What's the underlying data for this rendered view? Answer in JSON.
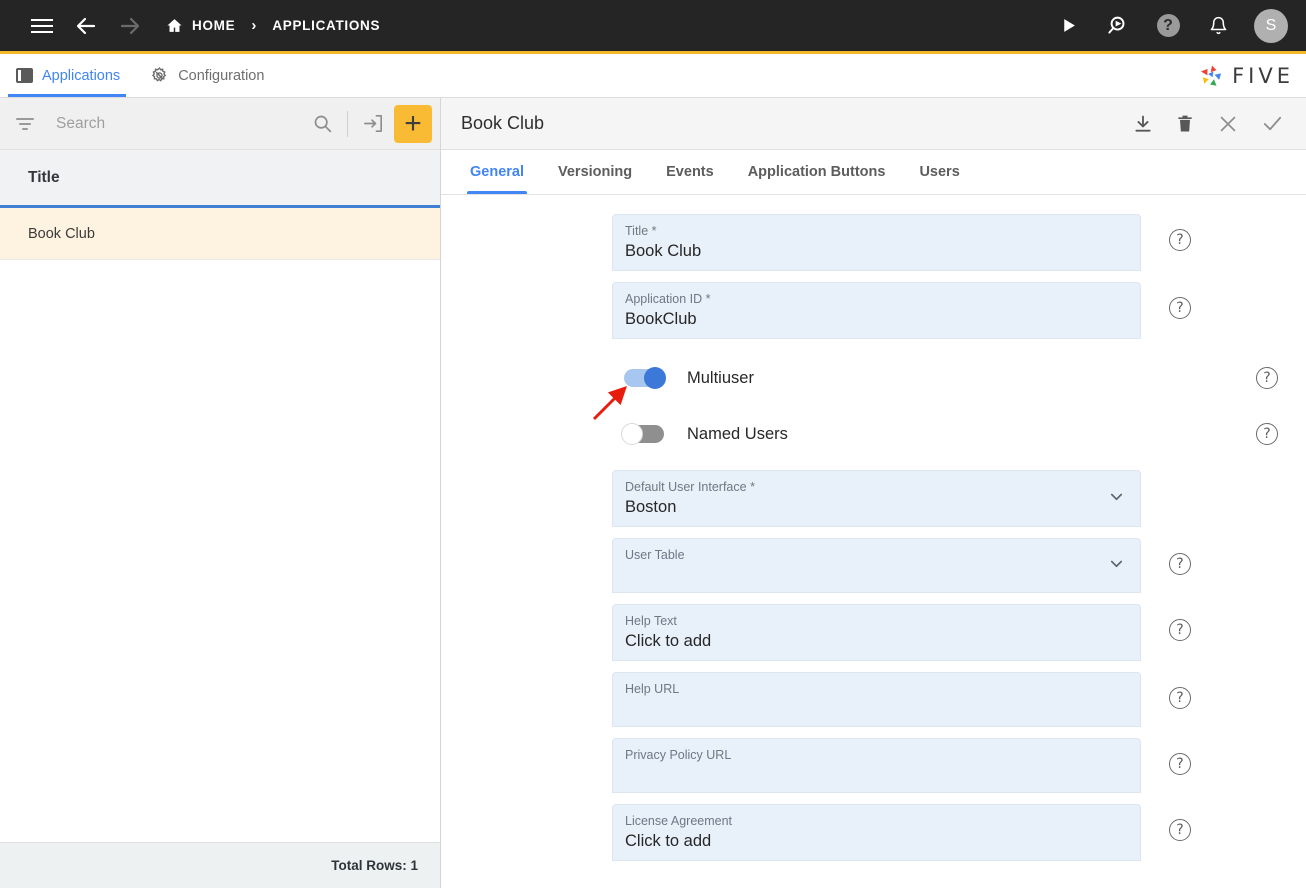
{
  "topbar": {
    "menu_icon": "hamburger-icon",
    "back_icon": "arrow-left-icon",
    "forward_icon": "arrow-right-icon",
    "home_label": "HOME",
    "separator": "›",
    "current_crumb": "APPLICATIONS",
    "run_icon": "play-icon",
    "search_run_icon": "search-run-icon",
    "help_icon": "question-mark-icon",
    "notifications_icon": "bell-icon",
    "avatar_initial": "S",
    "accent_color": "#f4b728",
    "background_color": "#252525"
  },
  "apptabs": {
    "items": [
      {
        "label": "Applications",
        "icon": "panel-icon",
        "active": true
      },
      {
        "label": "Configuration",
        "icon": "gear-wrench-icon",
        "active": false
      }
    ],
    "brand_name": "FIVE",
    "active_color": "#4285f4"
  },
  "left_panel": {
    "search": {
      "placeholder": "Search",
      "value": ""
    },
    "filter_icon": "filter-icon",
    "search_icon": "search-icon",
    "import_icon": "import-into-box-icon",
    "add_label": "+",
    "add_color": "#f9bb34",
    "column_header": "Title",
    "rows": [
      {
        "title": "Book Club",
        "selected": true
      }
    ],
    "footer_text": "Total Rows: 1"
  },
  "right_panel": {
    "title": "Book Club",
    "actions": [
      {
        "name": "download-icon",
        "glyph": "download"
      },
      {
        "name": "delete-icon",
        "glyph": "trash"
      },
      {
        "name": "close-icon",
        "glyph": "x"
      },
      {
        "name": "save-icon",
        "glyph": "check"
      }
    ],
    "tabs": [
      {
        "label": "General",
        "active": true
      },
      {
        "label": "Versioning",
        "active": false
      },
      {
        "label": "Events",
        "active": false
      },
      {
        "label": "Application Buttons",
        "active": false
      },
      {
        "label": "Users",
        "active": false
      }
    ],
    "fields": [
      {
        "label": "Title",
        "required": true,
        "value": "Book Club",
        "type": "text",
        "help": true
      },
      {
        "label": "Application ID",
        "required": true,
        "value": "BookClub",
        "type": "text",
        "help": true
      },
      {
        "label": "Default User Interface",
        "required": true,
        "value": "Boston",
        "type": "select",
        "help": false
      },
      {
        "label": "User Table",
        "required": false,
        "value": "",
        "type": "select",
        "help": true
      },
      {
        "label": "Help Text",
        "required": false,
        "value": "Click to add",
        "type": "text",
        "help": true
      },
      {
        "label": "Help URL",
        "required": false,
        "value": "",
        "type": "text",
        "help": true
      },
      {
        "label": "Privacy Policy URL",
        "required": false,
        "value": "",
        "type": "text",
        "help": true
      },
      {
        "label": "License Agreement",
        "required": false,
        "value": "Click to add",
        "type": "text",
        "help": true
      }
    ],
    "toggles": [
      {
        "label": "Multiuser",
        "on": true,
        "help": true
      },
      {
        "label": "Named Users",
        "on": false,
        "help": true
      }
    ],
    "required_marker": "*",
    "help_glyph": "?",
    "annotation": {
      "type": "red-arrow",
      "color": "#e81b0f",
      "points_to": "Multiuser"
    }
  }
}
